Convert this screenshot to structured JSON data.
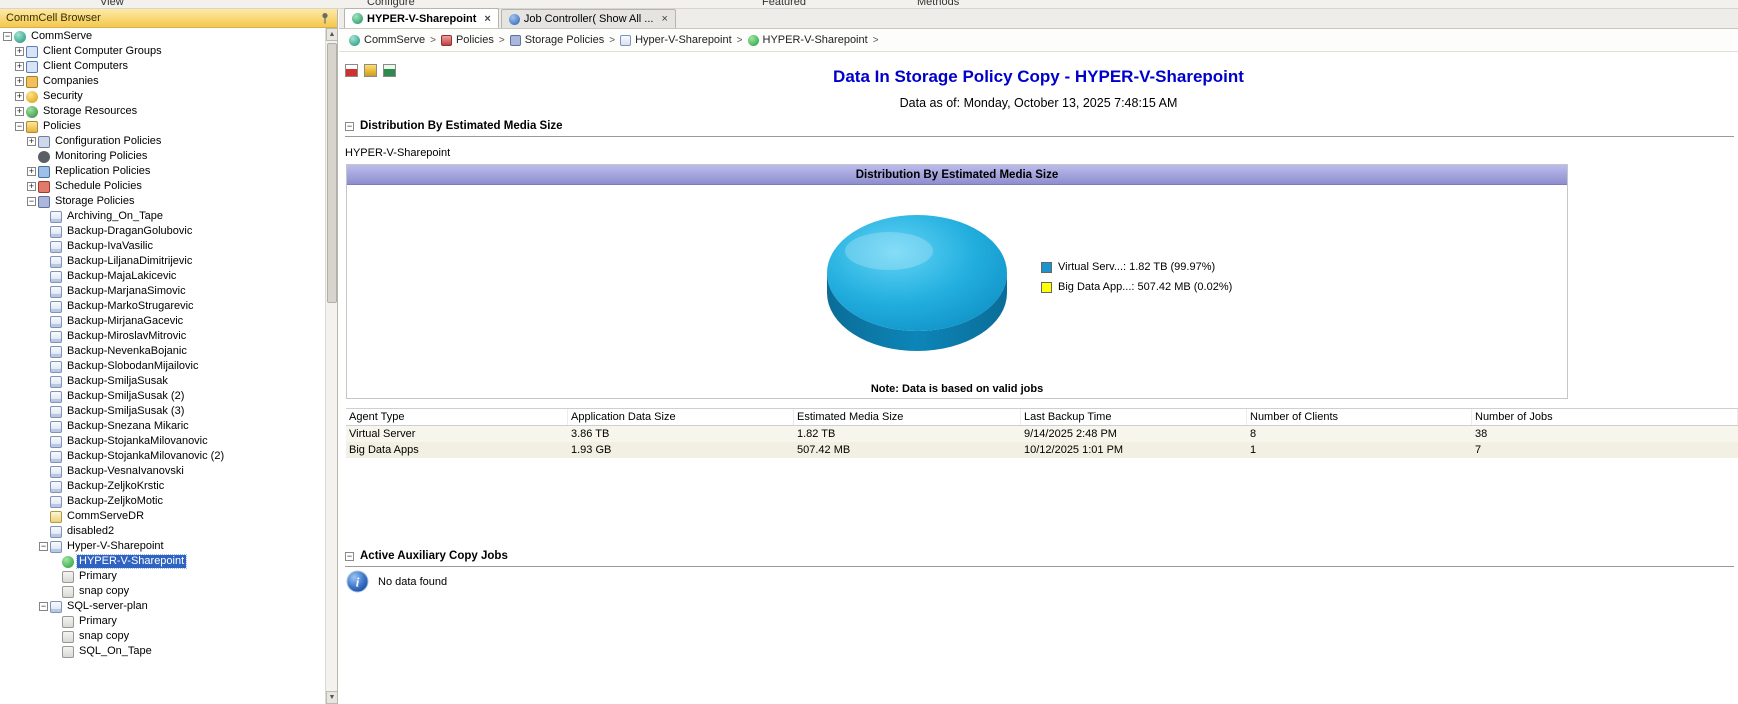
{
  "top_toolbar": {
    "items": [
      "View",
      "Configure",
      "Featured",
      "Methods"
    ]
  },
  "sidebar": {
    "title": "CommCell Browser",
    "tree": [
      {
        "label": "CommServe",
        "level": 0,
        "expand": "-",
        "icon": "commserve-icon"
      },
      {
        "label": "Client Computer Groups",
        "level": 1,
        "expand": "+",
        "icon": "client-computer-groups-icon"
      },
      {
        "label": "Client Computers",
        "level": 1,
        "expand": "+",
        "icon": "client-computers-icon"
      },
      {
        "label": "Companies",
        "level": 1,
        "expand": "+",
        "icon": "companies-icon"
      },
      {
        "label": "Security",
        "level": 1,
        "expand": "+",
        "icon": "security-icon"
      },
      {
        "label": "Storage Resources",
        "level": 1,
        "expand": "+",
        "icon": "storage-resources-icon"
      },
      {
        "label": "Policies",
        "level": 1,
        "expand": "-",
        "icon": "policies-icon"
      },
      {
        "label": "Configuration Policies",
        "level": 2,
        "expand": "+",
        "icon": "configuration-policies-icon"
      },
      {
        "label": "Monitoring Policies",
        "level": 2,
        "expand": null,
        "icon": "monitoring-policies-icon"
      },
      {
        "label": "Replication Policies",
        "level": 2,
        "expand": "+",
        "icon": "replication-policies-icon"
      },
      {
        "label": "Schedule Policies",
        "level": 2,
        "expand": "+",
        "icon": "schedule-policies-icon"
      },
      {
        "label": "Storage Policies",
        "level": 2,
        "expand": "-",
        "icon": "storage-policies-icon"
      },
      {
        "label": "Archiving_On_Tape",
        "level": 3,
        "expand": null,
        "icon": "storage-policy-icon"
      },
      {
        "label": "Backup-DraganGolubovic",
        "level": 3,
        "expand": null,
        "icon": "storage-policy-icon"
      },
      {
        "label": "Backup-IvaVasilic",
        "level": 3,
        "expand": null,
        "icon": "storage-policy-icon"
      },
      {
        "label": "Backup-LiljanaDimitrijevic",
        "level": 3,
        "expand": null,
        "icon": "storage-policy-icon"
      },
      {
        "label": "Backup-MajaLakicevic",
        "level": 3,
        "expand": null,
        "icon": "storage-policy-icon"
      },
      {
        "label": "Backup-MarjanaSimovic",
        "level": 3,
        "expand": null,
        "icon": "storage-policy-icon"
      },
      {
        "label": "Backup-MarkoStrugarevic",
        "level": 3,
        "expand": null,
        "icon": "storage-policy-icon"
      },
      {
        "label": "Backup-MirjanaGacevic",
        "level": 3,
        "expand": null,
        "icon": "storage-policy-icon"
      },
      {
        "label": "Backup-MiroslavMitrovic",
        "level": 3,
        "expand": null,
        "icon": "storage-policy-icon"
      },
      {
        "label": "Backup-NevenkaBojanic",
        "level": 3,
        "expand": null,
        "icon": "storage-policy-icon"
      },
      {
        "label": "Backup-SlobodanMijailovic",
        "level": 3,
        "expand": null,
        "icon": "storage-policy-icon"
      },
      {
        "label": "Backup-SmiljaSusak",
        "level": 3,
        "expand": null,
        "icon": "storage-policy-icon"
      },
      {
        "label": "Backup-SmiljaSusak (2)",
        "level": 3,
        "expand": null,
        "icon": "storage-policy-icon"
      },
      {
        "label": "Backup-SmiljaSusak (3)",
        "level": 3,
        "expand": null,
        "icon": "storage-policy-icon"
      },
      {
        "label": "Backup-Snezana Mikaric",
        "level": 3,
        "expand": null,
        "icon": "storage-policy-icon"
      },
      {
        "label": "Backup-StojankaMilovanovic",
        "level": 3,
        "expand": null,
        "icon": "storage-policy-icon"
      },
      {
        "label": "Backup-StojankaMilovanovic (2)",
        "level": 3,
        "expand": null,
        "icon": "storage-policy-icon"
      },
      {
        "label": "Backup-VesnaIvanovski",
        "level": 3,
        "expand": null,
        "icon": "storage-policy-icon"
      },
      {
        "label": "Backup-ZeljkoKrstic",
        "level": 3,
        "expand": null,
        "icon": "storage-policy-icon"
      },
      {
        "label": "Backup-ZeljkoMotic",
        "level": 3,
        "expand": null,
        "icon": "storage-policy-icon"
      },
      {
        "label": "CommServeDR",
        "level": 3,
        "expand": null,
        "icon": "commservedr-icon"
      },
      {
        "label": "disabled2",
        "level": 3,
        "expand": null,
        "icon": "storage-policy-icon"
      },
      {
        "label": "Hyper-V-Sharepoint",
        "level": 3,
        "expand": "-",
        "icon": "storage-policy-icon"
      },
      {
        "label": "HYPER-V-Sharepoint",
        "level": 4,
        "expand": null,
        "icon": "policy-copy-active-icon",
        "selected": true
      },
      {
        "label": "Primary",
        "level": 4,
        "expand": null,
        "icon": "copy-icon"
      },
      {
        "label": "snap copy",
        "level": 4,
        "expand": null,
        "icon": "copy-icon"
      },
      {
        "label": "SQL-server-plan",
        "level": 3,
        "expand": "-",
        "icon": "storage-policy-icon"
      },
      {
        "label": "Primary",
        "level": 4,
        "expand": null,
        "icon": "copy-icon"
      },
      {
        "label": "snap copy",
        "level": 4,
        "expand": null,
        "icon": "copy-icon"
      },
      {
        "label": "SQL_On_Tape",
        "level": 4,
        "expand": null,
        "icon": "copy-icon"
      }
    ]
  },
  "tabs": [
    {
      "label": "HYPER-V-Sharepoint",
      "icon": "storage-policy-tab-icon",
      "active": true
    },
    {
      "label": "Job Controller( Show All ...",
      "icon": "job-controller-tab-icon",
      "active": false
    }
  ],
  "breadcrumb": {
    "separator": ">",
    "items": [
      {
        "label": "CommServe",
        "icon": "bc-commserve-icon"
      },
      {
        "label": "Policies",
        "icon": "bc-policies-icon"
      },
      {
        "label": "Storage Policies",
        "icon": "bc-storage-policies-icon"
      },
      {
        "label": "Hyper-V-Sharepoint",
        "icon": "bc-storage-policy-icon"
      },
      {
        "label": "HYPER-V-Sharepoint",
        "icon": "bc-policy-copy-icon"
      }
    ]
  },
  "report": {
    "title": "Data In Storage Policy Copy - HYPER-V-Sharepoint",
    "data_as_of": "Data as of: Monday, October 13, 2025 7:48:15 AM",
    "section1_title": "Distribution By Estimated Media Size",
    "policy_label": "HYPER-V-Sharepoint",
    "section2_title": "Active Auxiliary Copy Jobs",
    "no_data": "No data found"
  },
  "chart_data": {
    "type": "pie",
    "title": "Distribution By Estimated Media Size",
    "note": "Note: Data is based on valid jobs",
    "legend_position": "right",
    "slices": [
      {
        "name": "Virtual Server",
        "label": "Virtual Serv...: 1.82 TB (99.97%)",
        "value_percent": 99.97,
        "value_label": "1.82 TB",
        "color": "#1b94ce"
      },
      {
        "name": "Big Data Apps",
        "label": "Big Data App...: 507.42 MB (0.02%)",
        "value_percent": 0.02,
        "value_label": "507.42 MB",
        "color": "#ffff00"
      }
    ]
  },
  "table": {
    "headers": [
      "Agent Type",
      "Application Data Size",
      "Estimated Media Size",
      "Last Backup Time",
      "Number of Clients",
      "Number of Jobs"
    ],
    "rows": [
      [
        "Virtual Server",
        "3.86 TB",
        "1.82 TB",
        "9/14/2025 2:48 PM",
        "8",
        "38"
      ],
      [
        "Big Data Apps",
        "1.93 GB",
        "507.42 MB",
        "10/12/2025 1:01 PM",
        "1",
        "7"
      ]
    ]
  }
}
